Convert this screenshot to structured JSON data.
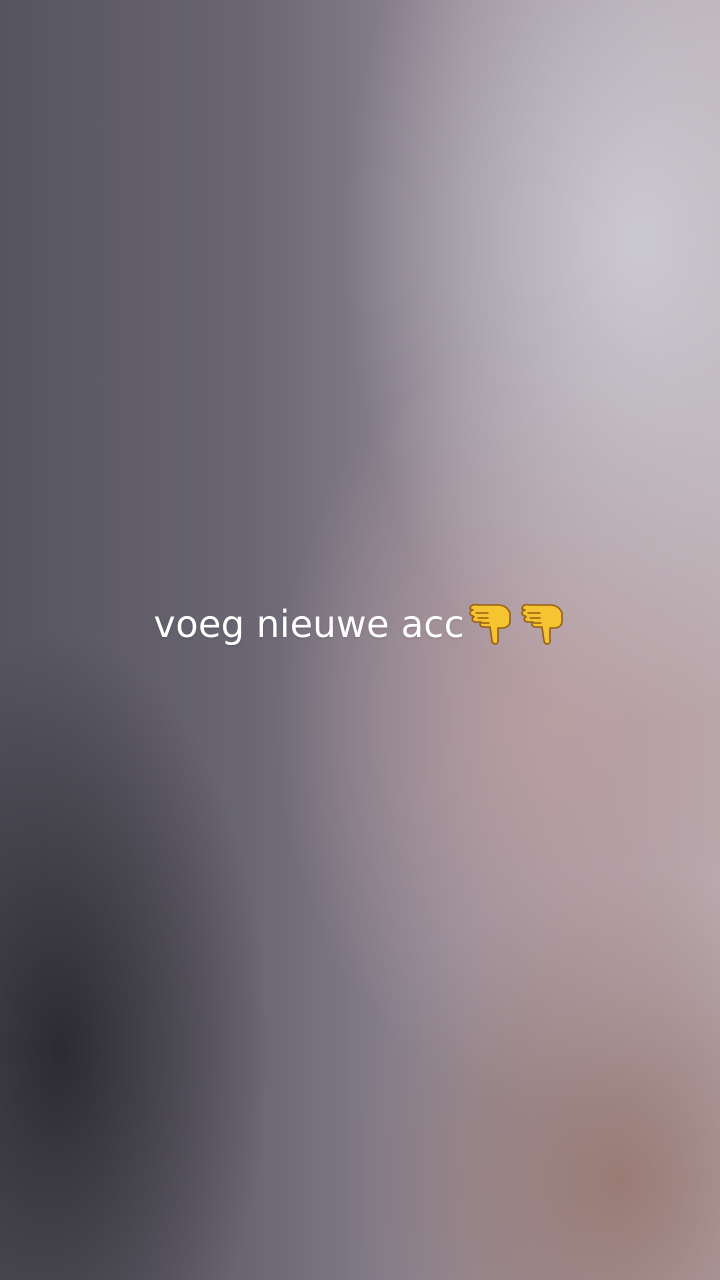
{
  "caption": {
    "text": "voeg nieuwe acc",
    "emoji": [
      "pointing-down-hand-icon",
      "pointing-down-hand-icon"
    ]
  },
  "colors": {
    "text": "#ffffff",
    "emoji_fill": "#f5c431",
    "emoji_outline": "#9a5f12"
  }
}
